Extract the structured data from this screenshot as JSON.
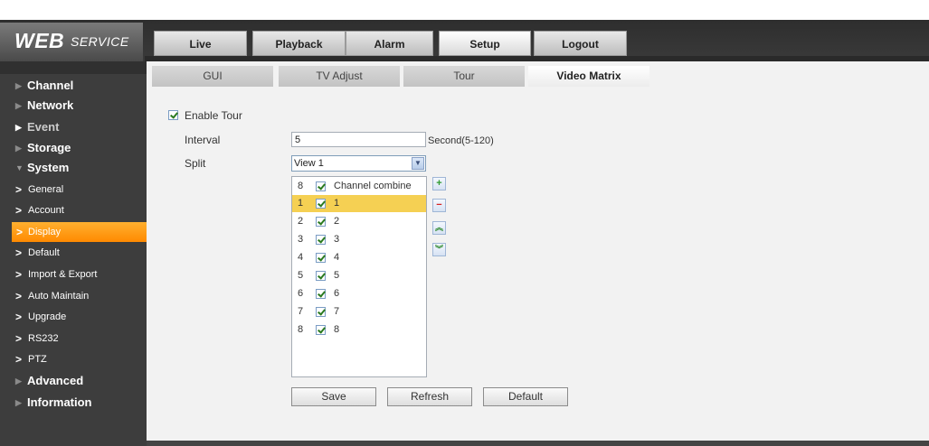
{
  "header": {
    "logo_main": "WEB",
    "logo_sub": "SERVICE",
    "tabs": [
      {
        "label": "Live"
      },
      {
        "label": "Playback"
      },
      {
        "label": "Alarm"
      },
      {
        "label": "Setup"
      },
      {
        "label": "Logout"
      }
    ],
    "active_tab": "Setup"
  },
  "sidebar": {
    "sections": [
      {
        "label": "Channel"
      },
      {
        "label": "Network"
      },
      {
        "label": "Event"
      },
      {
        "label": "Storage"
      },
      {
        "label": "System"
      },
      {
        "label": "Advanced"
      },
      {
        "label": "Information"
      }
    ],
    "system_items": [
      {
        "label": "General"
      },
      {
        "label": "Account"
      },
      {
        "label": "Display"
      },
      {
        "label": "Default"
      },
      {
        "label": "Import & Export"
      },
      {
        "label": "Auto Maintain"
      },
      {
        "label": "Upgrade"
      },
      {
        "label": "RS232"
      },
      {
        "label": "PTZ"
      }
    ],
    "active_item": "Display"
  },
  "subtabs": [
    {
      "label": "GUI"
    },
    {
      "label": "TV Adjust"
    },
    {
      "label": "Tour"
    },
    {
      "label": "Video Matrix"
    }
  ],
  "active_subtab": "Video Matrix",
  "form": {
    "enable_tour_label": "Enable Tour",
    "enable_tour_checked": true,
    "interval_label": "Interval",
    "interval_value": "5",
    "interval_unit": "Second(5-120)",
    "split_label": "Split",
    "split_value": "View 1"
  },
  "channel_list": {
    "header": {
      "num": "8",
      "label": "Channel combine"
    },
    "rows": [
      {
        "num": "1",
        "name": "1",
        "checked": true,
        "selected": true
      },
      {
        "num": "2",
        "name": "2",
        "checked": true,
        "selected": false
      },
      {
        "num": "3",
        "name": "3",
        "checked": true,
        "selected": false
      },
      {
        "num": "4",
        "name": "4",
        "checked": true,
        "selected": false
      },
      {
        "num": "5",
        "name": "5",
        "checked": true,
        "selected": false
      },
      {
        "num": "6",
        "name": "6",
        "checked": true,
        "selected": false
      },
      {
        "num": "7",
        "name": "7",
        "checked": true,
        "selected": false
      },
      {
        "num": "8",
        "name": "8",
        "checked": true,
        "selected": false
      }
    ]
  },
  "list_buttons": {
    "add": "+",
    "remove": "−",
    "up": "︽",
    "down": "︾"
  },
  "actions": {
    "save": "Save",
    "refresh": "Refresh",
    "default": "Default"
  },
  "colors": {
    "active_menu": "#ff9a1a",
    "selected_row": "#f5d053",
    "sidebar_bg": "#3d3d3d"
  }
}
